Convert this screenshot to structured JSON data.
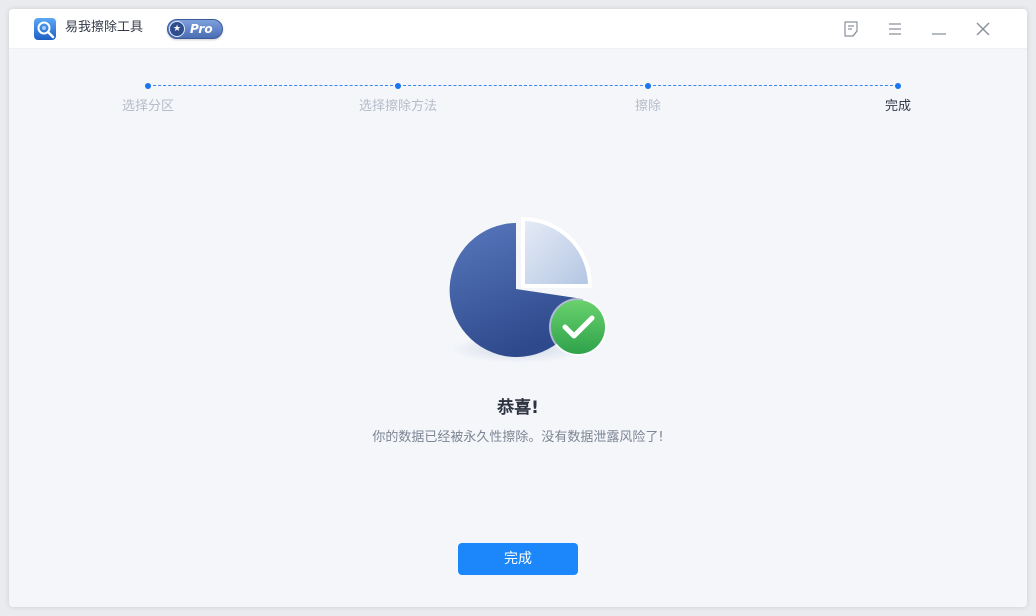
{
  "titlebar": {
    "title": "易我擦除工具",
    "badge": "Pro",
    "buttons": [
      "feedback-icon",
      "menu-icon",
      "minimize-icon",
      "close-icon"
    ]
  },
  "steps": [
    {
      "label": "选择分区",
      "state": "done"
    },
    {
      "label": "选择擦除方法",
      "state": "done"
    },
    {
      "label": "擦除",
      "state": "done"
    },
    {
      "label": "完成",
      "state": "current"
    }
  ],
  "result": {
    "heading": "恭喜!",
    "message": "你的数据已经被永久性擦除。没有数据泄露风险了!"
  },
  "actions": {
    "finish_label": "完成"
  },
  "colors": {
    "accent": "#1b87fa",
    "step_dot": "#1b74f0",
    "success": "#4cc25a",
    "pie_main": "#3f5fa3",
    "pie_slice": "#c9d6ea"
  }
}
